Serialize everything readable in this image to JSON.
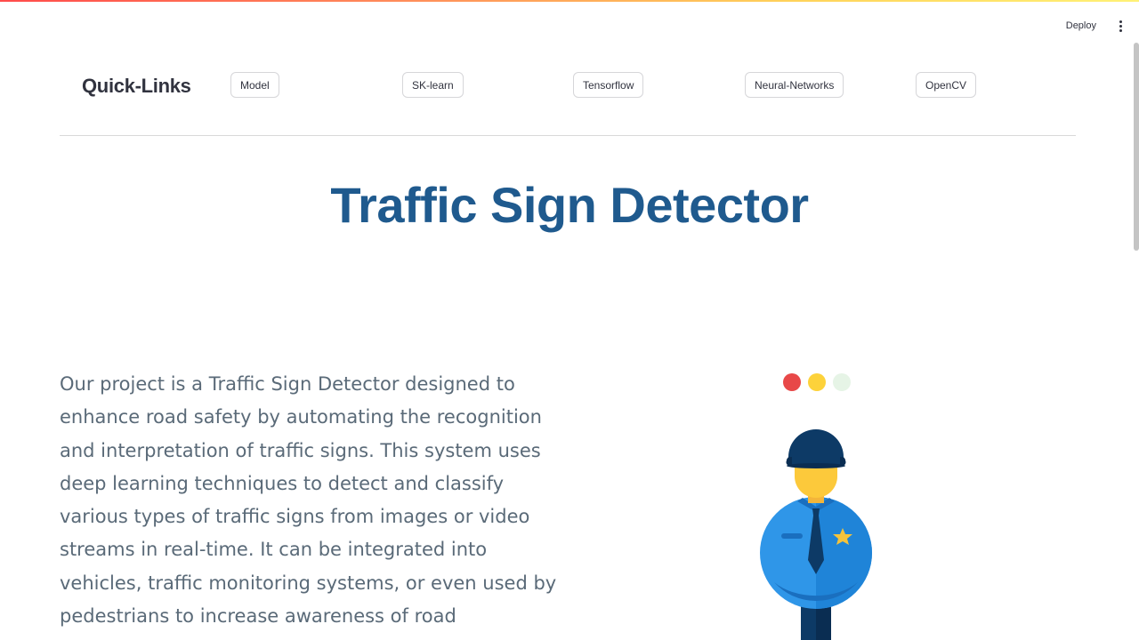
{
  "header": {
    "deploy_label": "Deploy",
    "menu_icon": "more-vertical-icon"
  },
  "quick_links": {
    "heading": "Quick-Links",
    "buttons": [
      {
        "label": "Model"
      },
      {
        "label": "SK-learn"
      },
      {
        "label": "Tensorflow"
      },
      {
        "label": "Neural-Networks"
      },
      {
        "label": "OpenCV"
      }
    ]
  },
  "main": {
    "title": "Traffic Sign Detector",
    "description": "Our project is a Traffic Sign Detector designed to enhance road safety by automating the recognition and interpretation of traffic signs. This system uses deep learning techniques to detect and classify various types of traffic signs from images or video streams in real-time. It can be integrated into vehicles, traffic monitoring systems, or even used by pedestrians to increase awareness of road"
  },
  "illustration": {
    "traffic_light_colors": [
      "#e84848",
      "#fdd23a",
      "#e6f4e6"
    ],
    "subject": "traffic-police-officer-icon"
  },
  "colors": {
    "title": "#1f5a8e",
    "accent_gradient": [
      "#ff4b4b",
      "#ffd35a"
    ]
  }
}
